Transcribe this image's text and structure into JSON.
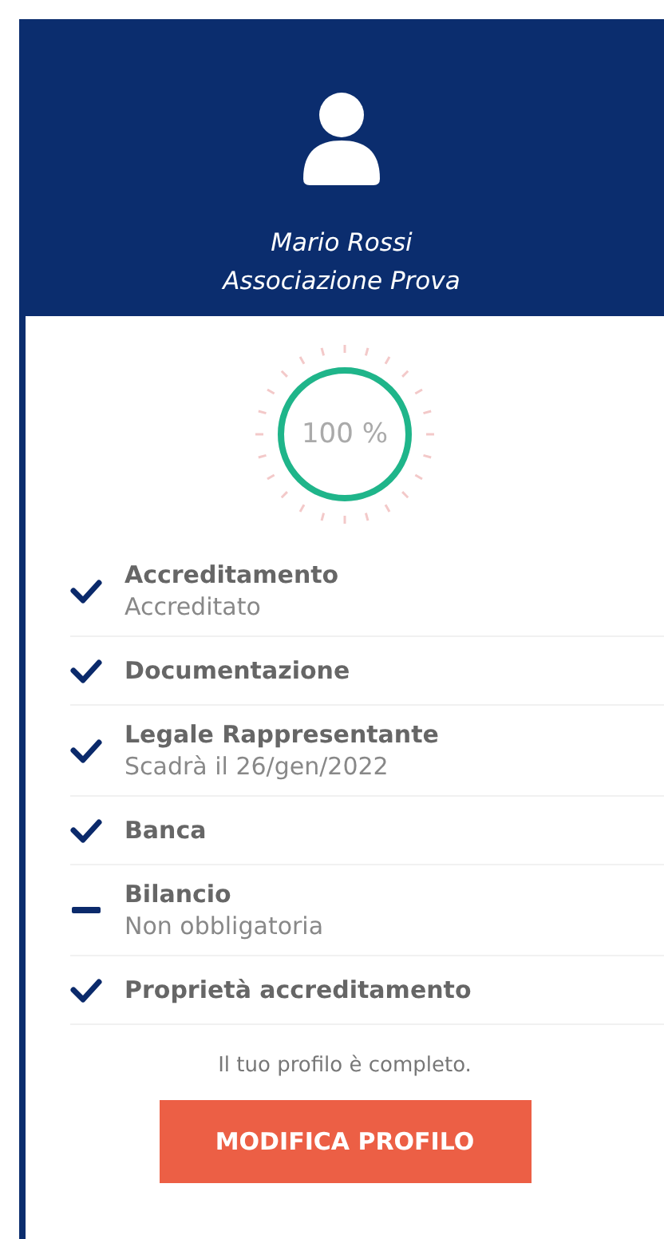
{
  "profile": {
    "name": "Mario Rossi",
    "organization": "Associazione Prova"
  },
  "progress": {
    "level": 1,
    "reading": "100 %"
  },
  "checklist": [
    {
      "title": "Accreditamento",
      "subtitle": "Accreditato",
      "kind": "done"
    },
    {
      "title": "Documentazione",
      "kind": "done"
    },
    {
      "title": "Legale Rappresentante",
      "subtitle": "Scadrà il 26/gen/2022",
      "kind": "done"
    },
    {
      "title": "Banca",
      "kind": "done"
    },
    {
      "title": "Bilancio",
      "subtitle": "Non obbligatoria",
      "kind": "optional"
    },
    {
      "title": "Proprietà accreditamento",
      "kind": "done"
    }
  ],
  "message": "Il tuo profilo è completo.",
  "button": "MODIFICA PROFILO"
}
